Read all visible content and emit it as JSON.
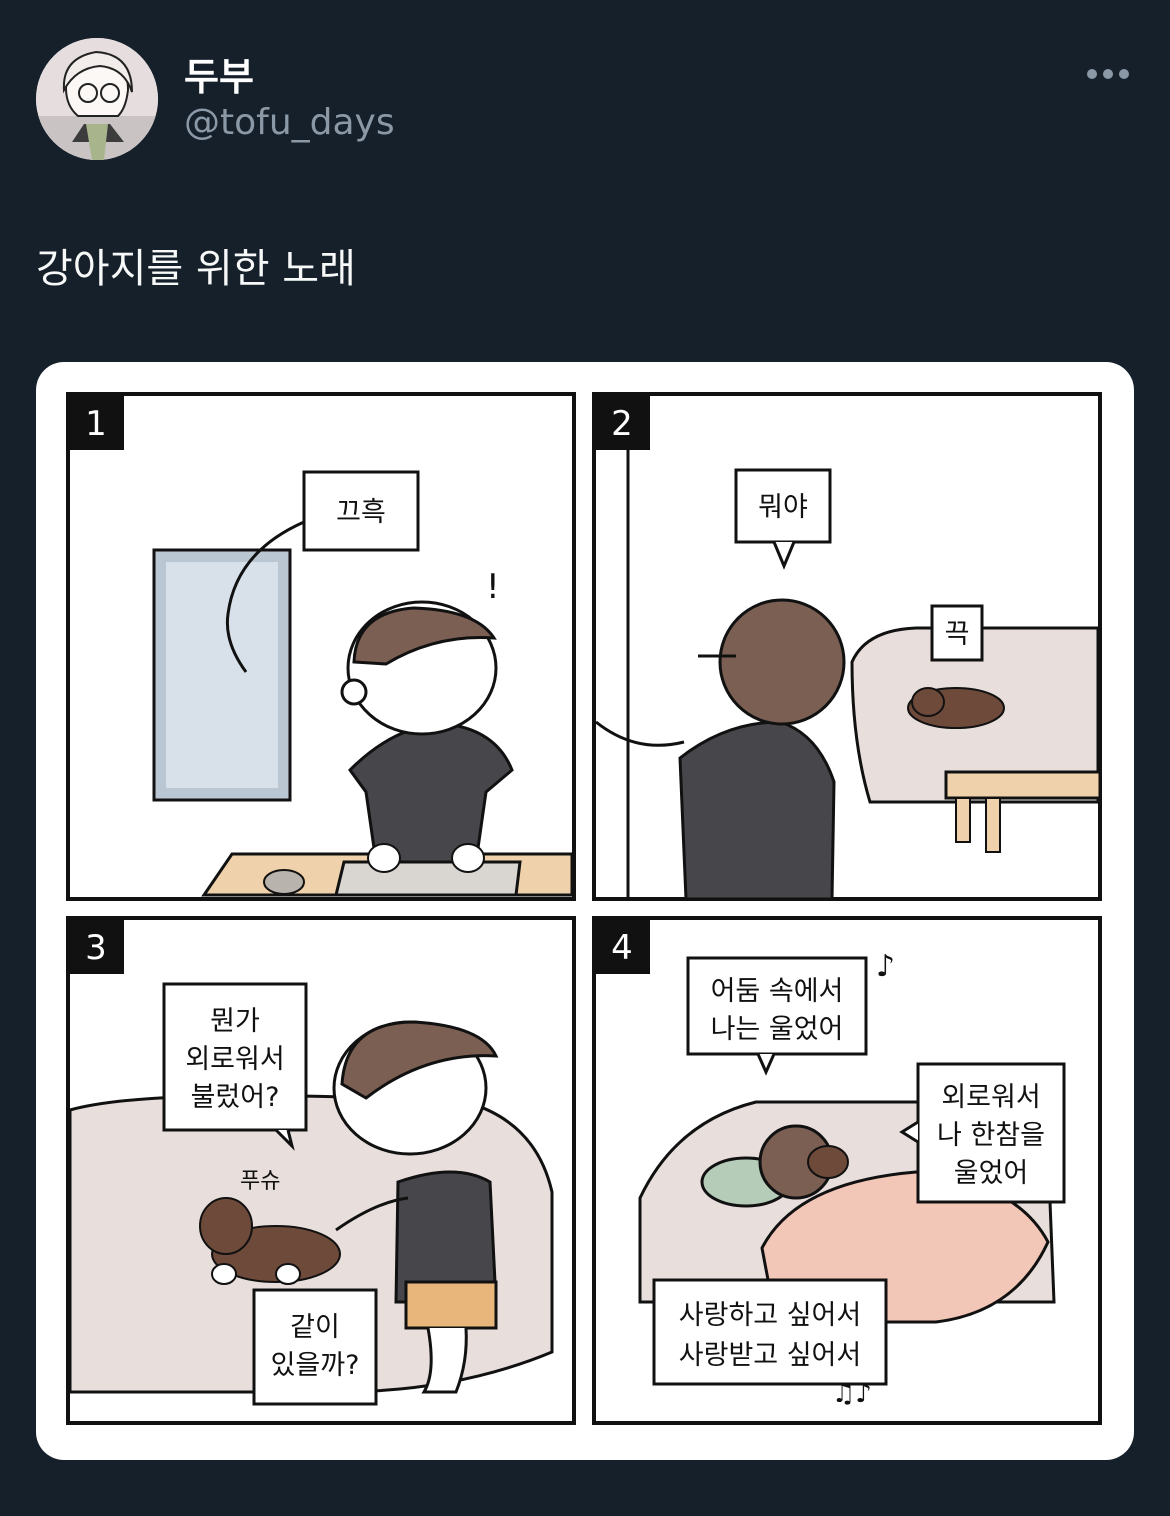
{
  "user": {
    "display_name": "두부",
    "handle": "@tofu_days"
  },
  "menu": {
    "icon": "more-horizontal-icon"
  },
  "tweet": {
    "text": "강아지를 위한 노래"
  },
  "comic": {
    "panels": [
      {
        "number": "1",
        "bubbles": [
          "끄흑"
        ],
        "sfx": "!"
      },
      {
        "number": "2",
        "bubbles": [
          "뭐야",
          "끅"
        ]
      },
      {
        "number": "3",
        "bubbles": [
          "뭔가",
          "외로워서",
          "불렀어?",
          "같이",
          "있을까?"
        ],
        "sfx": "푸슈"
      },
      {
        "number": "4",
        "bubbles": [
          "어둠 속에서",
          "나는 울었어",
          "외로워서",
          "나 한참을",
          "울었어",
          "사랑하고 싶어서",
          "사랑받고 싶어서"
        ]
      }
    ]
  },
  "colors": {
    "background": "#15202b",
    "handle": "#8b98a5",
    "shirt": "#47464b",
    "hair": "#7a5f52",
    "dog": "#6e4a3a",
    "desk": "#efd2ab",
    "sofa": "#e8dfdc"
  }
}
